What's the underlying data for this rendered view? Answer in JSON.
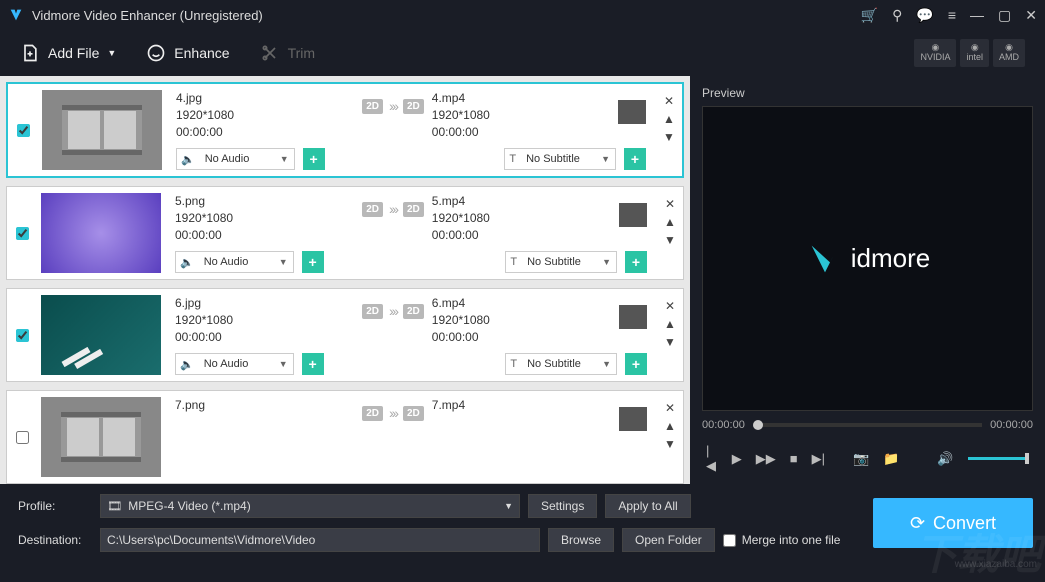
{
  "window": {
    "title": "Vidmore Video Enhancer (Unregistered)"
  },
  "toolbar": {
    "addFile": "Add File",
    "enhance": "Enhance",
    "trim": "Trim"
  },
  "gpu": {
    "nvidia": "NVIDIA",
    "intel": "intel",
    "amd": "AMD"
  },
  "items": [
    {
      "srcName": "4.jpg",
      "srcRes": "1920*1080",
      "srcDur": "00:00:00",
      "dstName": "4.mp4",
      "dstRes": "1920*1080",
      "dstDur": "00:00:00",
      "audio": "No Audio",
      "subtitle": "No Subtitle",
      "checked": true,
      "selected": true,
      "thumb": "film"
    },
    {
      "srcName": "5.png",
      "srcRes": "1920*1080",
      "srcDur": "00:00:00",
      "dstName": "5.mp4",
      "dstRes": "1920*1080",
      "dstDur": "00:00:00",
      "audio": "No Audio",
      "subtitle": "No Subtitle",
      "checked": true,
      "selected": false,
      "thumb": "purple"
    },
    {
      "srcName": "6.jpg",
      "srcRes": "1920*1080",
      "srcDur": "00:00:00",
      "dstName": "6.mp4",
      "dstRes": "1920*1080",
      "dstDur": "00:00:00",
      "audio": "No Audio",
      "subtitle": "No Subtitle",
      "checked": true,
      "selected": false,
      "thumb": "teal"
    },
    {
      "srcName": "7.png",
      "srcRes": "",
      "srcDur": "",
      "dstName": "7.mp4",
      "dstRes": "",
      "dstDur": "",
      "audio": "",
      "subtitle": "",
      "checked": false,
      "selected": false,
      "thumb": "film"
    }
  ],
  "badge2D": "2D",
  "preview": {
    "title": "Preview",
    "brand": "idmore",
    "timeStart": "00:00:00",
    "timeEnd": "00:00:00"
  },
  "footer": {
    "profileLabel": "Profile:",
    "profileValue": "MPEG-4 Video (*.mp4)",
    "settings": "Settings",
    "applyAll": "Apply to All",
    "destLabel": "Destination:",
    "destValue": "C:\\Users\\pc\\Documents\\Vidmore\\Video",
    "browse": "Browse",
    "openFolder": "Open Folder",
    "merge": "Merge into one file",
    "convert": "Convert"
  },
  "watermark": "下载吧",
  "watermarkUrl": "www.xiazaiba.com"
}
